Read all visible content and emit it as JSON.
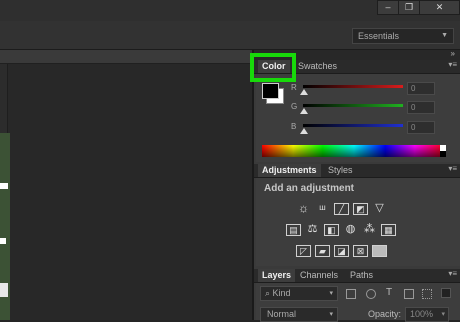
{
  "window": {
    "minimize": "–",
    "maximize": "❐",
    "close": "✕"
  },
  "options_bar": {
    "workspace": "Essentials"
  },
  "dock": {
    "collapse": "»"
  },
  "color_panel": {
    "tabs": [
      "Color",
      "Swatches"
    ],
    "sliders": [
      {
        "label": "R",
        "value": "0",
        "color": "#d81c1c"
      },
      {
        "label": "G",
        "value": "0",
        "color": "#20b020"
      },
      {
        "label": "B",
        "value": "0",
        "color": "#2030d0"
      }
    ],
    "foreground": "#000000",
    "background": "#ffffff"
  },
  "adjustments_panel": {
    "tabs": [
      "Adjustments",
      "Styles"
    ],
    "heading": "Add an adjustment",
    "icons_row1": [
      "brightness-icon",
      "levels-icon",
      "curves-icon",
      "exposure-icon",
      "vibrance-icon"
    ],
    "icons_row2": [
      "hue-saturation-icon",
      "color-balance-icon",
      "black-white-icon",
      "photo-filter-icon",
      "channel-mixer-icon",
      "color-lookup-icon"
    ],
    "icons_row3": [
      "invert-icon",
      "posterize-icon",
      "threshold-icon",
      "selective-color-icon",
      "gradient-map-icon"
    ]
  },
  "layers_panel": {
    "tabs": [
      "Layers",
      "Channels",
      "Paths"
    ],
    "filter_kind": "Kind",
    "blend_mode": "Normal",
    "opacity_label": "Opacity:",
    "opacity_value": "100%"
  }
}
